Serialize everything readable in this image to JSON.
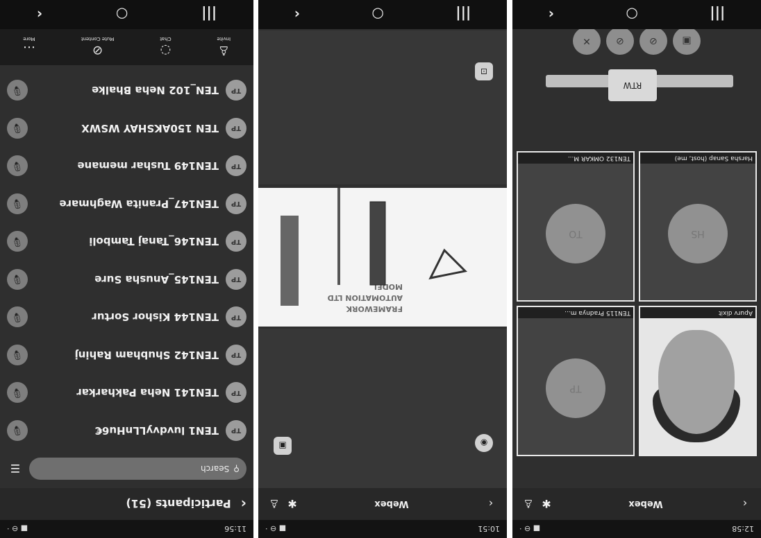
{
  "panel1": {
    "status": {
      "time": "11:56",
      "right": "■ ⊖ ·"
    },
    "header": {
      "title": "Participants (51)"
    },
    "search": {
      "placeholder": "Search"
    },
    "participants": [
      {
        "name": "TEN1 luvdvyLLnHu6€",
        "avatar": "TP"
      },
      {
        "name": "TEN141 Neha Pakharkar",
        "avatar": "TP"
      },
      {
        "name": "TEN142 Shubham Rahinj",
        "avatar": "TP"
      },
      {
        "name": "TEN144 Kishor Sortur",
        "avatar": "TP"
      },
      {
        "name": "TEN145_Anusha Sure",
        "avatar": "TP"
      },
      {
        "name": "TEN146_Tanaj Tamboli",
        "avatar": "TP"
      },
      {
        "name": "TEN147_Pranita Waghmare",
        "avatar": "TP"
      },
      {
        "name": "TEN149 Tushar memane",
        "avatar": "TP"
      },
      {
        "name": "TEN 150AKSHAY WSWX",
        "avatar": "TP"
      },
      {
        "name": "TEN_102 Neha Bhalke",
        "avatar": "TP"
      }
    ],
    "tools": [
      {
        "label": "Invite",
        "icon": "person-add"
      },
      {
        "label": "Chat",
        "icon": "chat"
      },
      {
        "label": "Mute Content",
        "icon": "mic-off"
      },
      {
        "label": "More",
        "icon": "more"
      }
    ]
  },
  "panel2": {
    "status": {
      "time": "10:51"
    },
    "topbar": {
      "brand": "Webex"
    },
    "share": {
      "lines": [
        "FRAMEWORK",
        "AUTOMATION LTD",
        "MODEL"
      ]
    }
  },
  "panel3": {
    "status": {
      "time": "12:58"
    },
    "topbar": {
      "brand": "Webex"
    },
    "tiles": [
      {
        "name": "Apurv dixit",
        "avatar": "",
        "photo": true
      },
      {
        "name": "TEN115 Pradnya m...",
        "avatar": "TP",
        "photo": false
      },
      {
        "name": "Harsha Sanap (host, me)",
        "avatar": "HS",
        "photo": false
      },
      {
        "name": "TEN132 OMKAR M...",
        "avatar": "TO",
        "photo": false
      }
    ],
    "overlay_tag": "RTW",
    "controls": [
      "▣",
      "⊘",
      "⊘",
      "✕"
    ]
  }
}
